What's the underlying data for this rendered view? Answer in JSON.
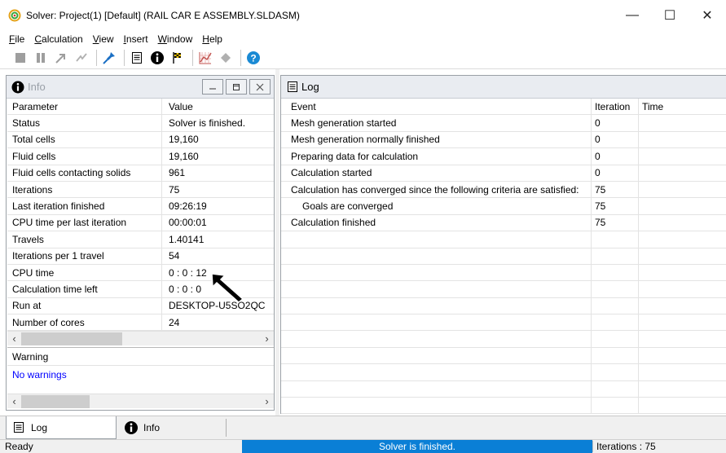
{
  "window": {
    "title": "Solver: Project(1) [Default] (RAIL CAR E ASSEMBLY.SLDASM)",
    "controls": {
      "minimize": "—",
      "maximize": "☐",
      "close": "✕"
    }
  },
  "menu": {
    "items": [
      {
        "ul": "F",
        "rest": "ile"
      },
      {
        "ul": "C",
        "rest": "alculation"
      },
      {
        "ul": "V",
        "rest": "iew"
      },
      {
        "ul": "I",
        "rest": "nsert"
      },
      {
        "ul": "W",
        "rest": "indow"
      },
      {
        "ul": "H",
        "rest": "elp"
      }
    ]
  },
  "info_panel": {
    "title": "Info",
    "headers": {
      "parameter": "Parameter",
      "value": "Value"
    },
    "rows": [
      {
        "parameter": "Status",
        "value": "Solver is finished."
      },
      {
        "parameter": "Total cells",
        "value": "19,160"
      },
      {
        "parameter": "Fluid cells",
        "value": "19,160"
      },
      {
        "parameter": "Fluid cells contacting solids",
        "value": "961"
      },
      {
        "parameter": "Iterations",
        "value": "75"
      },
      {
        "parameter": "Last iteration finished",
        "value": "09:26:19"
      },
      {
        "parameter": "CPU time per last iteration",
        "value": "00:00:01"
      },
      {
        "parameter": "Travels",
        "value": "1.40141"
      },
      {
        "parameter": "Iterations per 1 travel",
        "value": "54"
      },
      {
        "parameter": "CPU time",
        "value": "0 : 0 : 12"
      },
      {
        "parameter": "Calculation time left",
        "value": "0 : 0 : 0"
      },
      {
        "parameter": "Run at",
        "value": "DESKTOP-U5SO2QC"
      },
      {
        "parameter": "Number of cores",
        "value": "24"
      }
    ],
    "warning_header": "Warning",
    "warning_text": "No warnings"
  },
  "log_panel": {
    "title": "Log",
    "headers": {
      "event": "Event",
      "iteration": "Iteration",
      "time": "Time"
    },
    "rows": [
      {
        "event": "Mesh generation started",
        "iteration": "0",
        "time": "",
        "indent": false
      },
      {
        "event": "Mesh generation normally finished",
        "iteration": "0",
        "time": "",
        "indent": false
      },
      {
        "event": "Preparing data for calculation",
        "iteration": "0",
        "time": "",
        "indent": false
      },
      {
        "event": "Calculation started",
        "iteration": "0",
        "time": "",
        "indent": false
      },
      {
        "event": "Calculation has converged since the following criteria are satisfied:",
        "iteration": "75",
        "time": "",
        "indent": false
      },
      {
        "event": "Goals are converged",
        "iteration": "75",
        "time": "",
        "indent": true
      },
      {
        "event": "Calculation finished",
        "iteration": "75",
        "time": "",
        "indent": false
      }
    ],
    "empty_rows": 11
  },
  "tabs": [
    {
      "label": "Log",
      "active": true
    },
    {
      "label": "Info",
      "active": false
    }
  ],
  "statusbar": {
    "left": "Ready",
    "progress_text": "Solver is finished.",
    "right": "Iterations : 75"
  },
  "colors": {
    "accent": "#0a7fd6",
    "warning_text": "#0000ff",
    "panel_header": "#e9ecf1"
  }
}
